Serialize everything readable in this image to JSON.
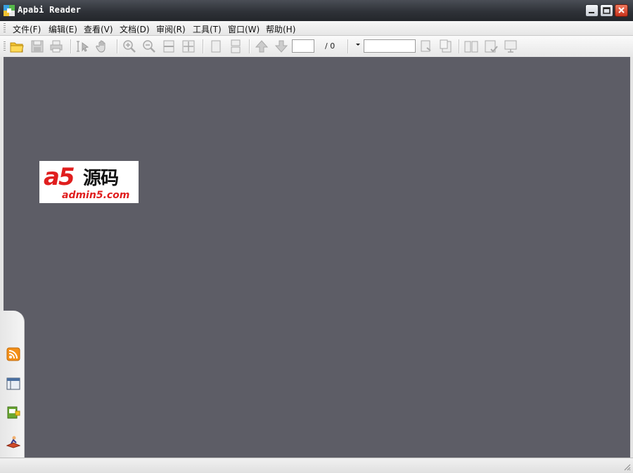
{
  "window": {
    "title": "Apabi Reader",
    "controls": [
      "minimize",
      "maximize",
      "close"
    ]
  },
  "menubar": {
    "items": [
      {
        "label": "文件(F)"
      },
      {
        "label": "编辑(E)"
      },
      {
        "label": "查看(V)"
      },
      {
        "label": "文档(D)"
      },
      {
        "label": "审阅(R)"
      },
      {
        "label": "工具(T)"
      },
      {
        "label": "窗口(W)"
      },
      {
        "label": "帮助(H)"
      }
    ]
  },
  "toolbar": {
    "icons": [
      "open-folder-icon",
      "save-icon",
      "print-icon",
      "select-text-icon",
      "hand-tool-icon",
      "zoom-in-icon",
      "zoom-out-icon",
      "fit-width-icon",
      "fit-page-icon",
      "single-page-icon",
      "continuous-page-icon",
      "previous-page-icon",
      "next-page-icon"
    ],
    "page_input_value": "",
    "page_total": "/ 0",
    "search_input_value": "",
    "trailing_icons": [
      "find-next-icon",
      "find-prev-icon",
      "book-view-icon",
      "bookmark-view-icon",
      "presentation-icon"
    ]
  },
  "sidebar": {
    "icons": [
      "rss-icon",
      "layout-panel-icon",
      "library-icon",
      "reading-icon"
    ]
  },
  "workspace": {
    "logo": {
      "mark": "a5",
      "text": "源码",
      "domain": "admin5.com"
    }
  },
  "colors": {
    "titlebar": "#2f3238",
    "workspace": "#5d5d66",
    "accent_red": "#e01e1e",
    "close_button": "#c7321c"
  }
}
